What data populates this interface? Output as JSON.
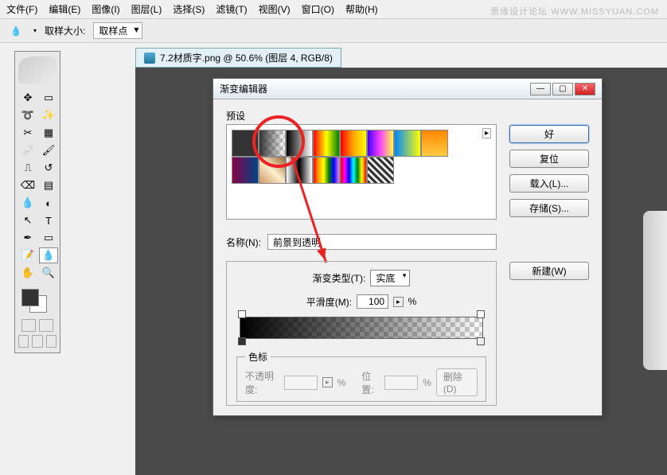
{
  "watermark": "思缘设计论坛  WWW.MISSYUAN.COM",
  "menu": {
    "file": "文件(F)",
    "edit": "编辑(E)",
    "image": "图像(I)",
    "layer": "图层(L)",
    "select": "选择(S)",
    "filter": "滤镜(T)",
    "view": "视图(V)",
    "window": "窗口(O)",
    "help": "帮助(H)"
  },
  "options": {
    "sample_size_label": "取样大小:",
    "sample_option": "取样点"
  },
  "doc": {
    "title": "7.2材质字.png @ 50.6% (图层 4, RGB/8)"
  },
  "dialog": {
    "title": "渐变编辑器",
    "presets_label": "预设",
    "name_label": "名称(N):",
    "name_value": "前景到透明",
    "type_label": "渐变类型(T):",
    "type_value": "实底",
    "smooth_label": "平滑度(M):",
    "smooth_value": "100",
    "pct": "%",
    "stops_label": "色标",
    "opacity_label": "不透明度:",
    "position_label": "位置:",
    "delete_label": "删除(D)",
    "btn_ok": "好",
    "btn_reset": "复位",
    "btn_load": "载入(L)...",
    "btn_save": "存储(S)...",
    "btn_new": "新建(W)"
  }
}
